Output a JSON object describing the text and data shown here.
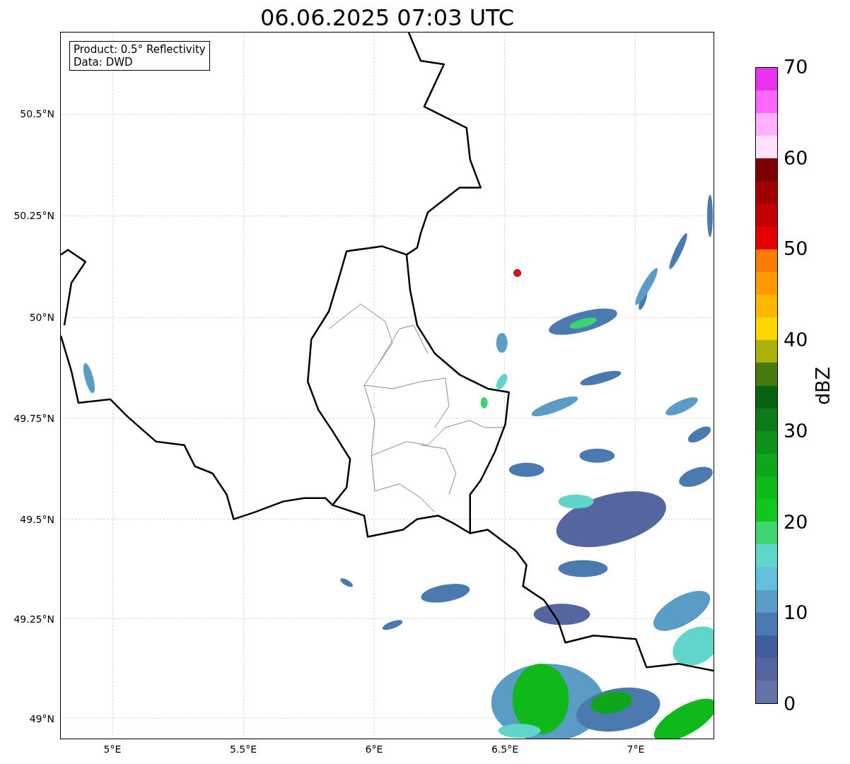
{
  "title": "06.06.2025 07:03 UTC",
  "info_box": [
    "Product: 0.5° Reflectivity",
    "Data: DWD"
  ],
  "x_ticks": [
    "5°E",
    "5.5°E",
    "6°E",
    "6.5°E",
    "7°E"
  ],
  "y_ticks": [
    "50.5°N",
    "50.25°N",
    "50°N",
    "49.75°N",
    "49.5°N",
    "49.25°N",
    "49°N"
  ],
  "colorbar": {
    "label": "dBZ",
    "ticks": [
      "70",
      "60",
      "50",
      "40",
      "30",
      "20",
      "10",
      "0"
    ],
    "bins": [
      {
        "color": "#e832f0"
      },
      {
        "color": "#ff66ff"
      },
      {
        "color": "#ffb0ff"
      },
      {
        "color": "#ffe0ff"
      },
      {
        "color": "#7c0000"
      },
      {
        "color": "#a00000"
      },
      {
        "color": "#c10000"
      },
      {
        "color": "#e20000"
      },
      {
        "color": "#fd7c00"
      },
      {
        "color": "#fd9a00"
      },
      {
        "color": "#fdb700"
      },
      {
        "color": "#fdd700"
      },
      {
        "color": "#acb00a"
      },
      {
        "color": "#477a0c"
      },
      {
        "color": "#08620f"
      },
      {
        "color": "#0c7a16"
      },
      {
        "color": "#0e901a"
      },
      {
        "color": "#10a61b"
      },
      {
        "color": "#10b91a"
      },
      {
        "color": "#10c81c"
      },
      {
        "color": "#3cd46c"
      },
      {
        "color": "#5fd6c8"
      },
      {
        "color": "#63bfdc"
      },
      {
        "color": "#5b9cc6"
      },
      {
        "color": "#4a7ab0"
      },
      {
        "color": "#425d9f"
      },
      {
        "color": "#53679e"
      },
      {
        "color": "#6474a8"
      }
    ]
  }
}
